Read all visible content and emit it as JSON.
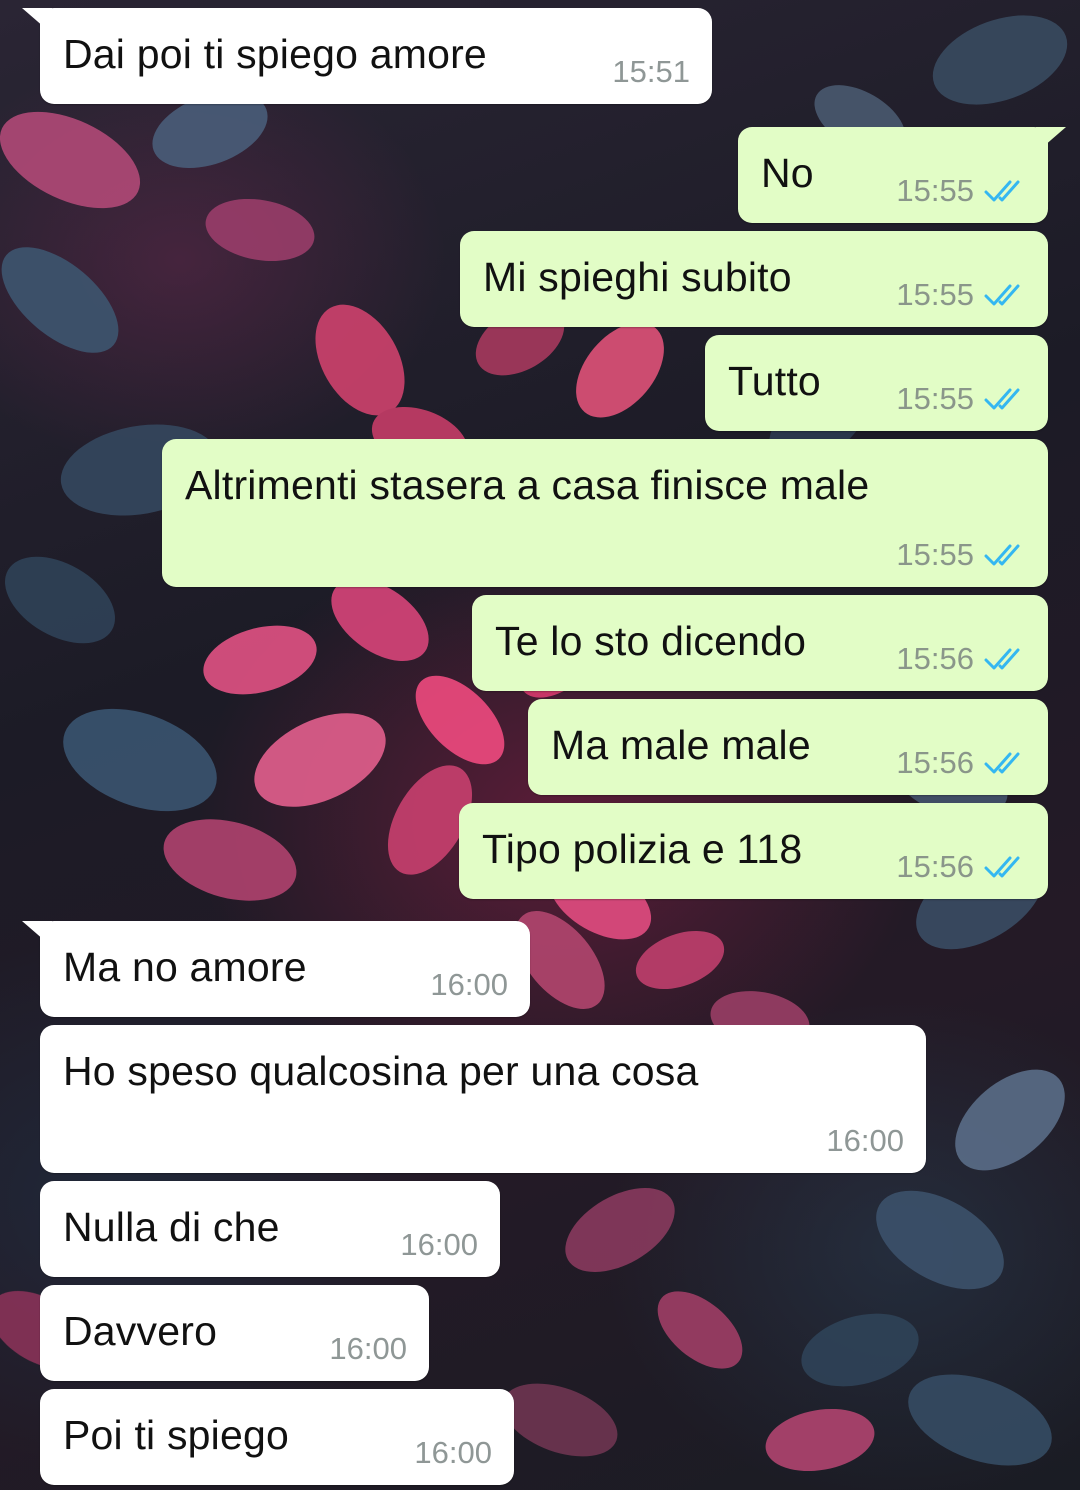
{
  "colors": {
    "incoming_bubble": "#ffffff",
    "outgoing_bubble": "#e2fdc6",
    "read_ticks": "#34b7f1",
    "timestamp": "#8f9796"
  },
  "messages": [
    {
      "direction": "incoming",
      "text": "Dai poi ti spiego amore",
      "time": "15:51"
    },
    {
      "direction": "outgoing",
      "text": "No",
      "time": "15:55",
      "status_icon": "double-check-read-icon"
    },
    {
      "direction": "outgoing",
      "text": "Mi spieghi subito",
      "time": "15:55",
      "status_icon": "double-check-read-icon"
    },
    {
      "direction": "outgoing",
      "text": "Tutto",
      "time": "15:55",
      "status_icon": "double-check-read-icon"
    },
    {
      "direction": "outgoing",
      "text": "Altrimenti stasera a casa finisce male",
      "time": "15:55",
      "status_icon": "double-check-read-icon"
    },
    {
      "direction": "outgoing",
      "text": "Te lo sto dicendo",
      "time": "15:56",
      "status_icon": "double-check-read-icon"
    },
    {
      "direction": "outgoing",
      "text": "Ma male male",
      "time": "15:56",
      "status_icon": "double-check-read-icon"
    },
    {
      "direction": "outgoing",
      "text": "Tipo polizia e 118",
      "time": "15:56",
      "status_icon": "double-check-read-icon"
    },
    {
      "direction": "incoming",
      "text": "Ma no amore",
      "time": "16:00"
    },
    {
      "direction": "incoming",
      "text": "Ho speso qualcosina per una cosa",
      "time": "16:00"
    },
    {
      "direction": "incoming",
      "text": "Nulla di che",
      "time": "16:00"
    },
    {
      "direction": "incoming",
      "text": "Davvero",
      "time": "16:00"
    },
    {
      "direction": "incoming",
      "text": "Poi ti spiego",
      "time": "16:00"
    }
  ]
}
